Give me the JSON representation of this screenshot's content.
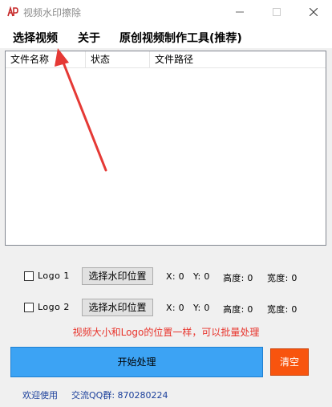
{
  "window": {
    "title": "视频水印擦除"
  },
  "menu": {
    "items": [
      "选择视频",
      "关于",
      "原创视频制作工具(推荐)"
    ]
  },
  "list": {
    "columns": [
      "文件名称",
      "状态",
      "文件路径"
    ]
  },
  "logo1": {
    "label": "Logo 1",
    "button": "选择水印位置",
    "x": "X: 0",
    "y": "Y: 0",
    "height": "高度: 0",
    "width": "宽度: 0"
  },
  "logo2": {
    "label": "Logo 2",
    "button": "选择水印位置",
    "x": "X: 0",
    "y": "Y: 0",
    "height": "高度: 0",
    "width": "宽度: 0"
  },
  "note": "视频大小和Logo的位置一样，可以批量处理",
  "actions": {
    "start": "开始处理",
    "clear": "清空"
  },
  "footer": {
    "welcome": "欢迎使用",
    "qq": "交流QQ群: 870280224"
  },
  "colors": {
    "start": "#3ca3f4",
    "clear": "#f8540e",
    "note": "#e8332b",
    "arrow": "#e53935"
  }
}
